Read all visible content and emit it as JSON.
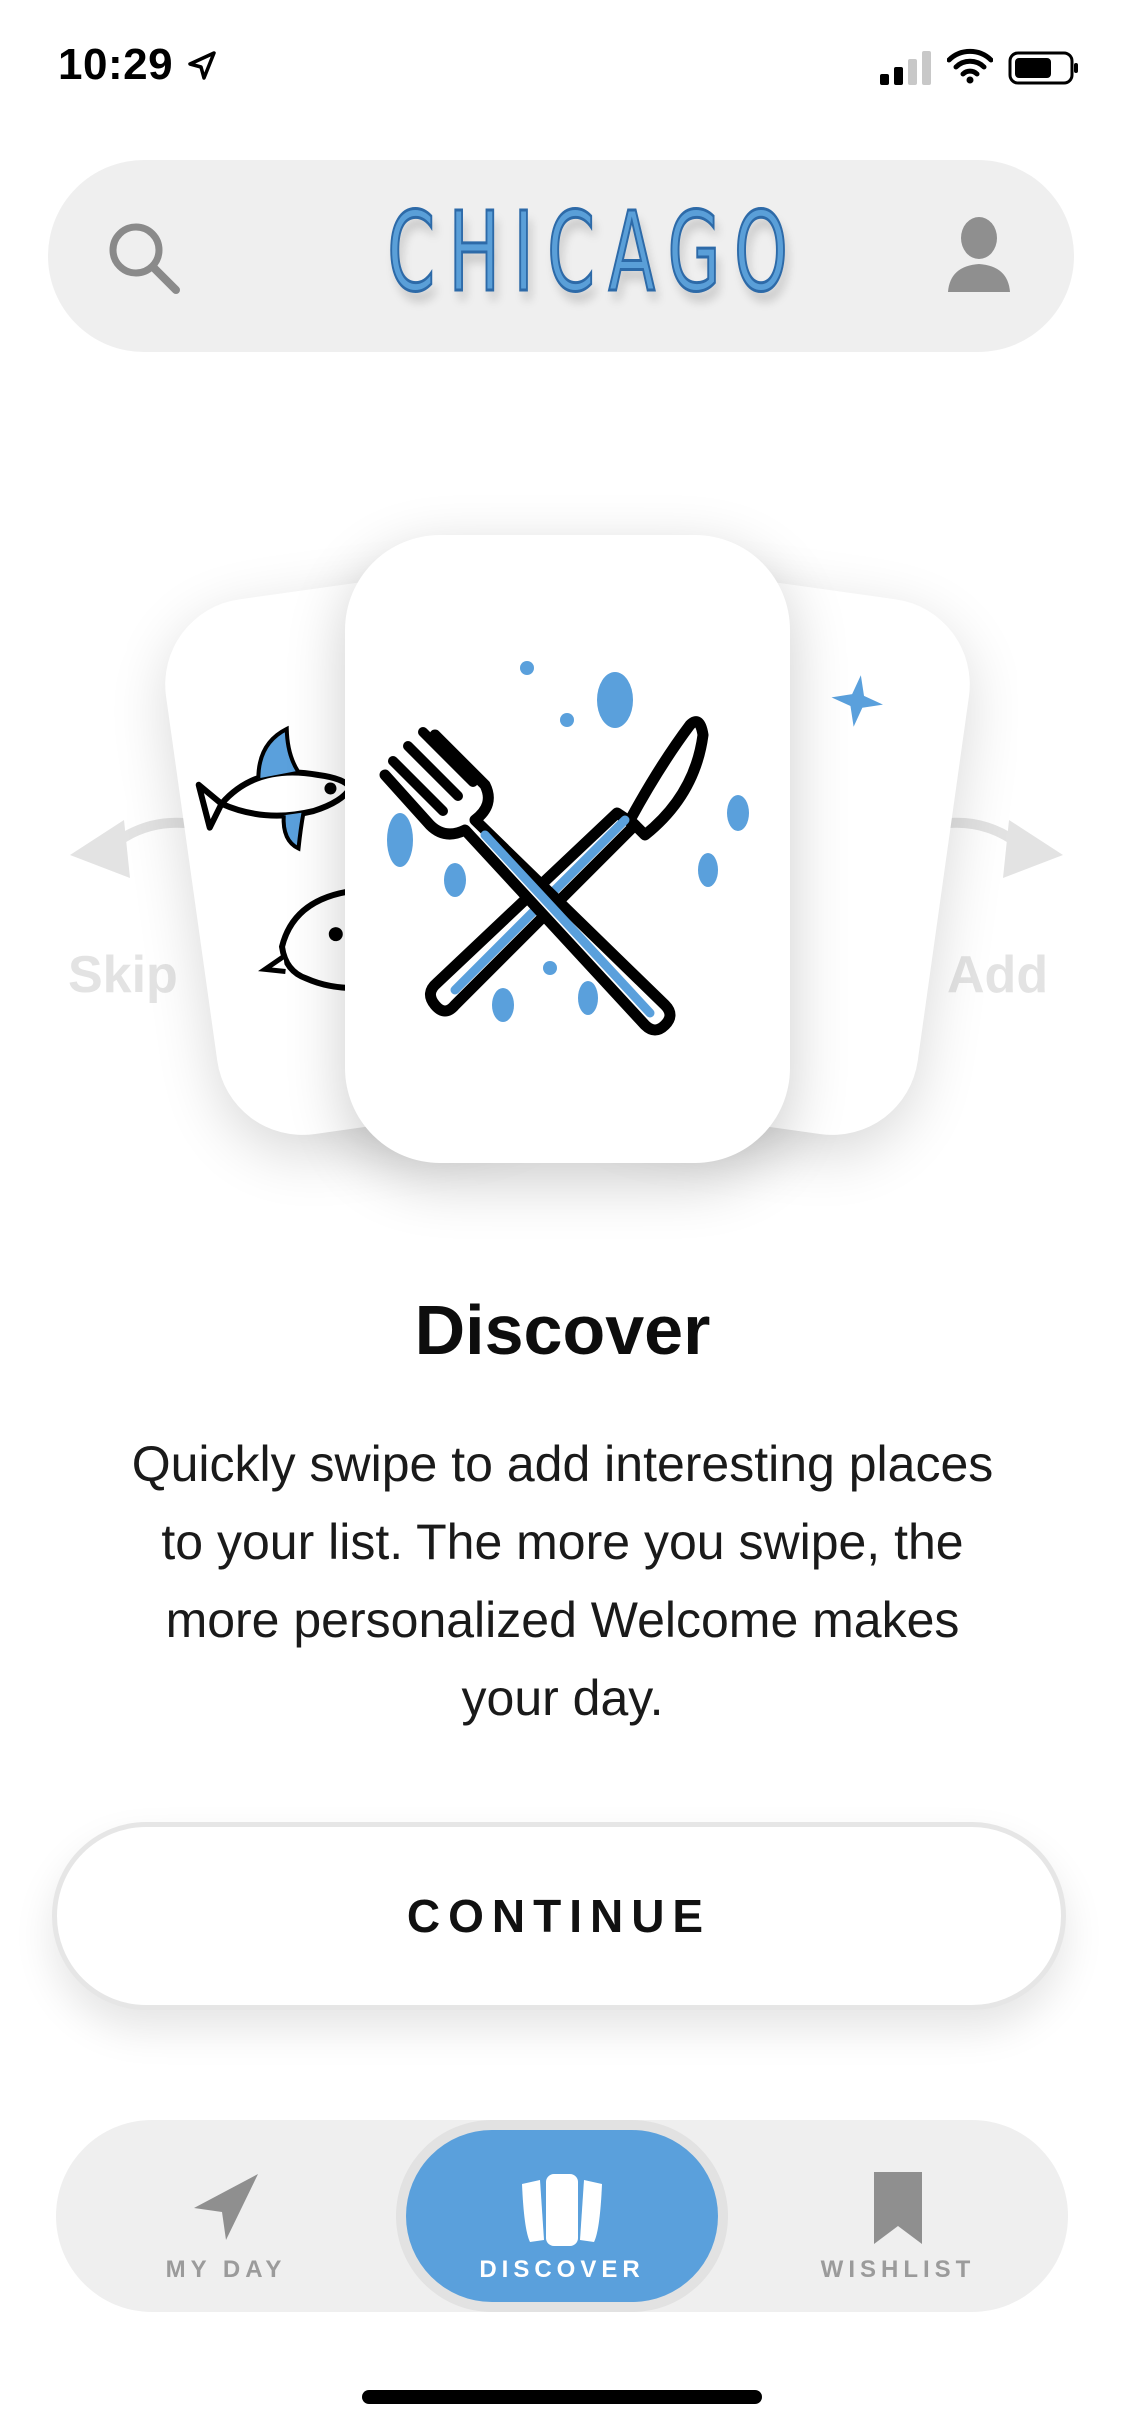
{
  "status_bar": {
    "time": "10:29"
  },
  "header": {
    "city_title": "CHICAGO"
  },
  "cards": {
    "skip_label": "Skip",
    "add_label": "Add"
  },
  "content": {
    "heading": "Discover",
    "description": "Quickly swipe to add interesting places to your list. The more you swipe, the more personalized Welcome makes your day."
  },
  "continue_button": {
    "label": "CONTINUE"
  },
  "tabbar": {
    "items": [
      {
        "label": "MY DAY",
        "icon": "navigation-arrow-icon",
        "active": false
      },
      {
        "label": "DISCOVER",
        "icon": "cards-icon",
        "active": true
      },
      {
        "label": "WISHLIST",
        "icon": "bookmark-icon",
        "active": false
      }
    ]
  },
  "colors": {
    "accent": "#5aa0dc",
    "tab_inactive": "#9b9b9b",
    "bar_background": "#efefef"
  }
}
